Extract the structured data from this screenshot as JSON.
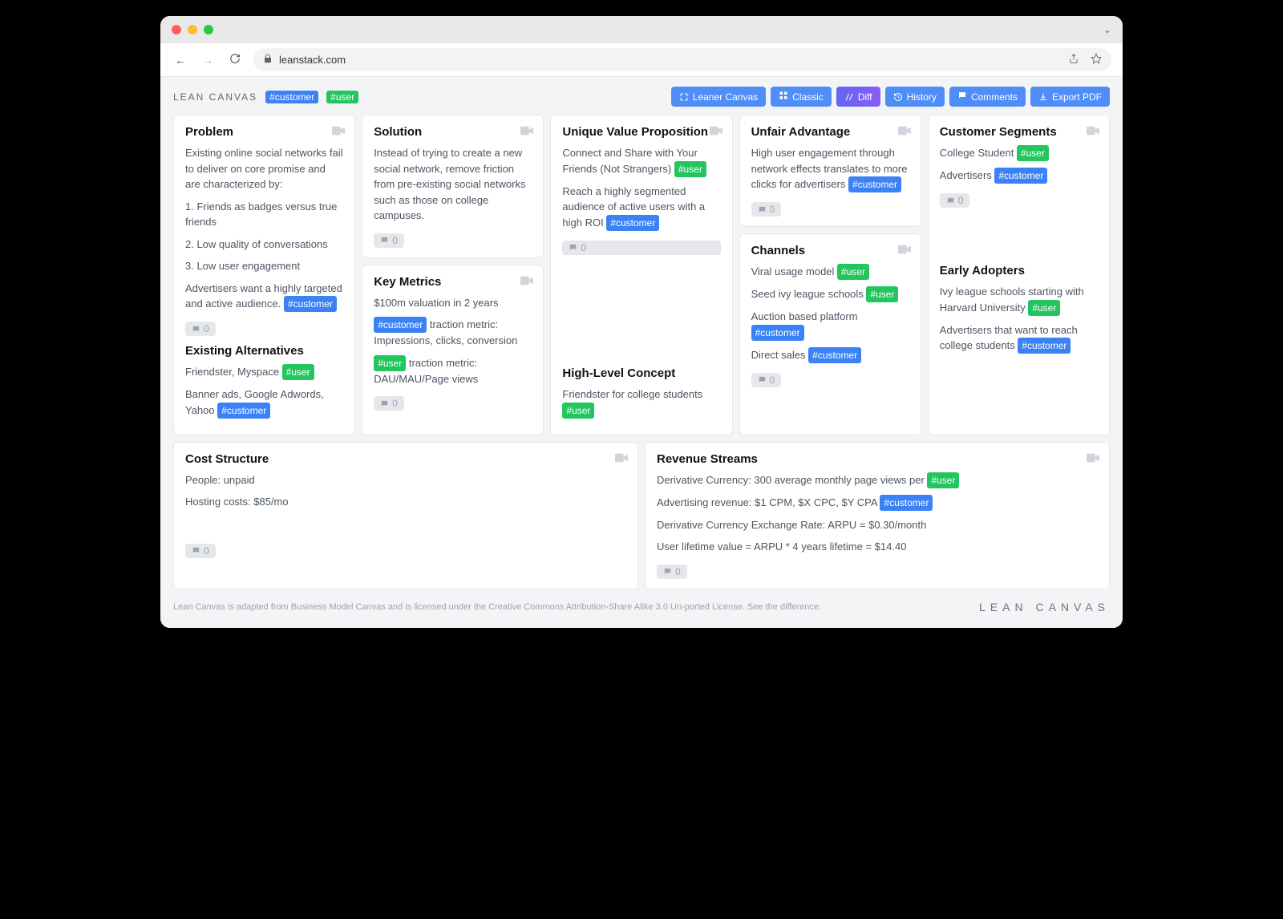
{
  "browser": {
    "url": "leanstack.com"
  },
  "header": {
    "brand": "LEAN CANVAS",
    "tags": {
      "customer": "#customer",
      "user": "#user"
    },
    "actions": {
      "leaner": "Leaner Canvas",
      "classic": "Classic",
      "diff": "Diff",
      "history": "History",
      "comments": "Comments",
      "export": "Export PDF"
    }
  },
  "cards": {
    "problem": {
      "title": "Problem",
      "intro": "Existing online social networks fail to deliver on core promise and are characterized by:",
      "p1": "1. Friends as badges versus true friends",
      "p2": "2. Low quality of conversations",
      "p3": "3. Low user engagement",
      "adv": "Advertisers want a highly targeted and active audience. ",
      "alt_title": "Existing Alternatives",
      "alt1": "Friendster, Myspace ",
      "alt2": "Banner ads, Google Adwords, Yahoo ",
      "comments": "0"
    },
    "solution": {
      "title": "Solution",
      "body": "Instead of trying to create a new social network, remove friction from pre-existing social networks such as those on college campuses.",
      "comments": "0"
    },
    "metrics": {
      "title": "Key Metrics",
      "l1": "$100m valuation in 2 years",
      "l2a": " traction metric: Impressions, clicks, conversion",
      "l3a": " traction metric: DAU/MAU/Page views",
      "comments": "0"
    },
    "uvp": {
      "title": "Unique Value Proposition",
      "l1": "Connect and Share with Your Friends (Not Strangers) ",
      "l2": "Reach a highly segmented audience of active users with a high ROI ",
      "hlc_title": "High-Level Concept",
      "hlc": "Friendster for college students ",
      "comments": "0"
    },
    "advantage": {
      "title": "Unfair Advantage",
      "body": "High user engagement through network effects translates to more clicks for advertisers ",
      "comments": "0"
    },
    "channels": {
      "title": "Channels",
      "l1": "Viral usage model ",
      "l2": "Seed ivy league schools ",
      "l3": "Auction based platform ",
      "l4": "Direct sales ",
      "comments": "0"
    },
    "segments": {
      "title": "Customer Segments",
      "l1": "College Student ",
      "l2": "Advertisers ",
      "ea_title": "Early Adopters",
      "ea1": "Ivy league schools starting with Harvard University ",
      "ea2": "Advertisers that want to reach college students ",
      "comments": "0"
    },
    "cost": {
      "title": "Cost Structure",
      "l1": "People: unpaid",
      "l2": "Hosting costs: $85/mo",
      "comments": "0"
    },
    "revenue": {
      "title": "Revenue Streams",
      "l1": "Derivative Currency: 300 average monthly page views per ",
      "l2": "Advertising revenue: $1 CPM, $X CPC, $Y CPA ",
      "l3": "Derivative Currency Exchange Rate: ARPU = $0.30/month",
      "l4": "User lifetime value = ARPU * 4 years lifetime = $14.40",
      "comments": "0"
    }
  },
  "footer": {
    "note": "Lean Canvas is adapted from Business Model Canvas and is licensed under the Creative Commons Attribution-Share Alike 3.0 Un-ported License. See the difference.",
    "brand": "LEAN CANVAS"
  }
}
